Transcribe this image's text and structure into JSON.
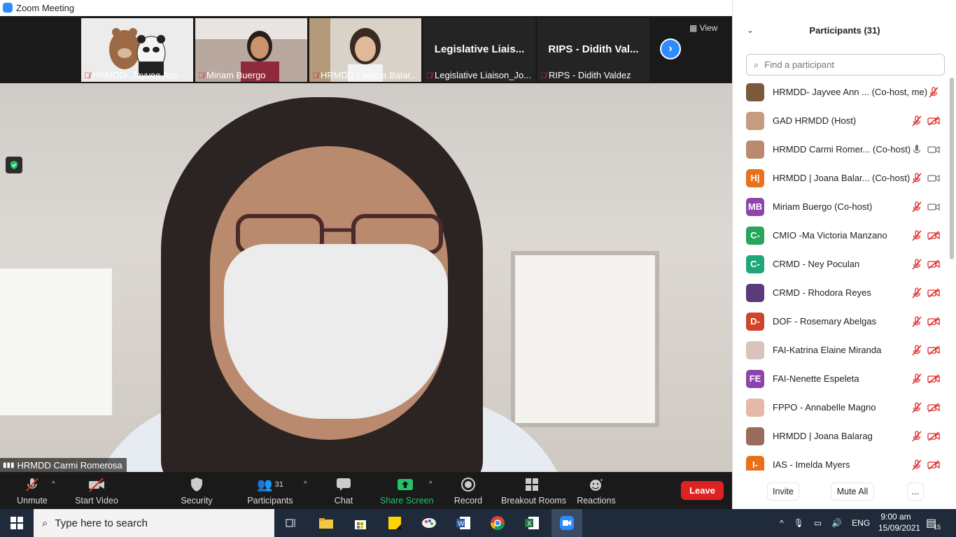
{
  "window": {
    "title": "Zoom Meeting",
    "controls": [
      "—",
      "❐",
      "✕"
    ]
  },
  "strip": {
    "view_label": "View",
    "tiles": [
      {
        "name": "HRMDD- Jayvee Ann ...",
        "type": "bears"
      },
      {
        "name": "Miriam Buergo",
        "type": "video"
      },
      {
        "name": "HRMDD | Joana Balar...",
        "type": "video"
      },
      {
        "name": "Legislative Liaison_Jo...",
        "big": "Legislative Liais..."
      },
      {
        "name": "RIPS - Didith Valdez",
        "big": "RIPS - Didith Val..."
      }
    ]
  },
  "main": {
    "active_speaker": "HRMDD Carmi Romerosa"
  },
  "toolbar": {
    "unmute": "Unmute",
    "start_video": "Start Video",
    "security": "Security",
    "participants": "Participants",
    "participants_count": "31",
    "chat": "Chat",
    "share_screen": "Share Screen",
    "record": "Record",
    "breakout": "Breakout Rooms",
    "reactions": "Reactions",
    "leave": "Leave"
  },
  "panel": {
    "title": "Participants (31)",
    "search_placeholder": "Find a participant",
    "participants": [
      {
        "name": "HRMDD- Jayvee Ann ...  (Co-host, me)",
        "avatar": "",
        "color": "#7b5a3c",
        "mic": "muted",
        "video": "none"
      },
      {
        "name": "GAD HRMDD (Host)",
        "avatar": "",
        "color": "#c79a82",
        "mic": "muted",
        "video": "off"
      },
      {
        "name": "HRMDD Carmi Romer... (Co-host)",
        "avatar": "",
        "color": "#b98a6e",
        "mic": "on",
        "video": "on"
      },
      {
        "name": "HRMDD | Joana Balar...  (Co-host)",
        "avatar": "H|",
        "color": "#e8711c",
        "mic": "muted",
        "video": "on"
      },
      {
        "name": "Miriam Buergo (Co-host)",
        "avatar": "MB",
        "color": "#8e44ad",
        "mic": "muted",
        "video": "on"
      },
      {
        "name": "CMIO -Ma Victoria Manzano",
        "avatar": "C-",
        "color": "#27a65a",
        "mic": "muted",
        "video": "off"
      },
      {
        "name": "CRMD - Ney Poculan",
        "avatar": "C-",
        "color": "#1fa67a",
        "mic": "muted",
        "video": "off"
      },
      {
        "name": "CRMD - Rhodora Reyes",
        "avatar": "",
        "color": "#5a3a7a",
        "mic": "muted",
        "video": "off"
      },
      {
        "name": "DOF - Rosemary Abelgas",
        "avatar": "D-",
        "color": "#d0442b",
        "mic": "muted",
        "video": "off"
      },
      {
        "name": "FAI-Katrina Elaine Miranda",
        "avatar": "",
        "color": "#d8c4bc",
        "mic": "muted",
        "video": "off"
      },
      {
        "name": "FAI-Nenette Espeleta",
        "avatar": "FE",
        "color": "#8e44ad",
        "mic": "muted",
        "video": "off"
      },
      {
        "name": "FPPO - Annabelle Magno",
        "avatar": "",
        "color": "#e6b8a8",
        "mic": "muted",
        "video": "off"
      },
      {
        "name": "HRMDD | Joana Balarag",
        "avatar": "",
        "color": "#9a6a5a",
        "mic": "muted",
        "video": "off"
      },
      {
        "name": "IAS - Imelda Myers",
        "avatar": "I-",
        "color": "#e8711c",
        "mic": "muted",
        "video": "off"
      }
    ],
    "invite": "Invite",
    "mute_all": "Mute All",
    "more": "..."
  },
  "taskbar": {
    "search_placeholder": "Type here to search",
    "language": "ENG",
    "time": "9:00 am",
    "date": "15/09/2021",
    "notifications": "15"
  }
}
